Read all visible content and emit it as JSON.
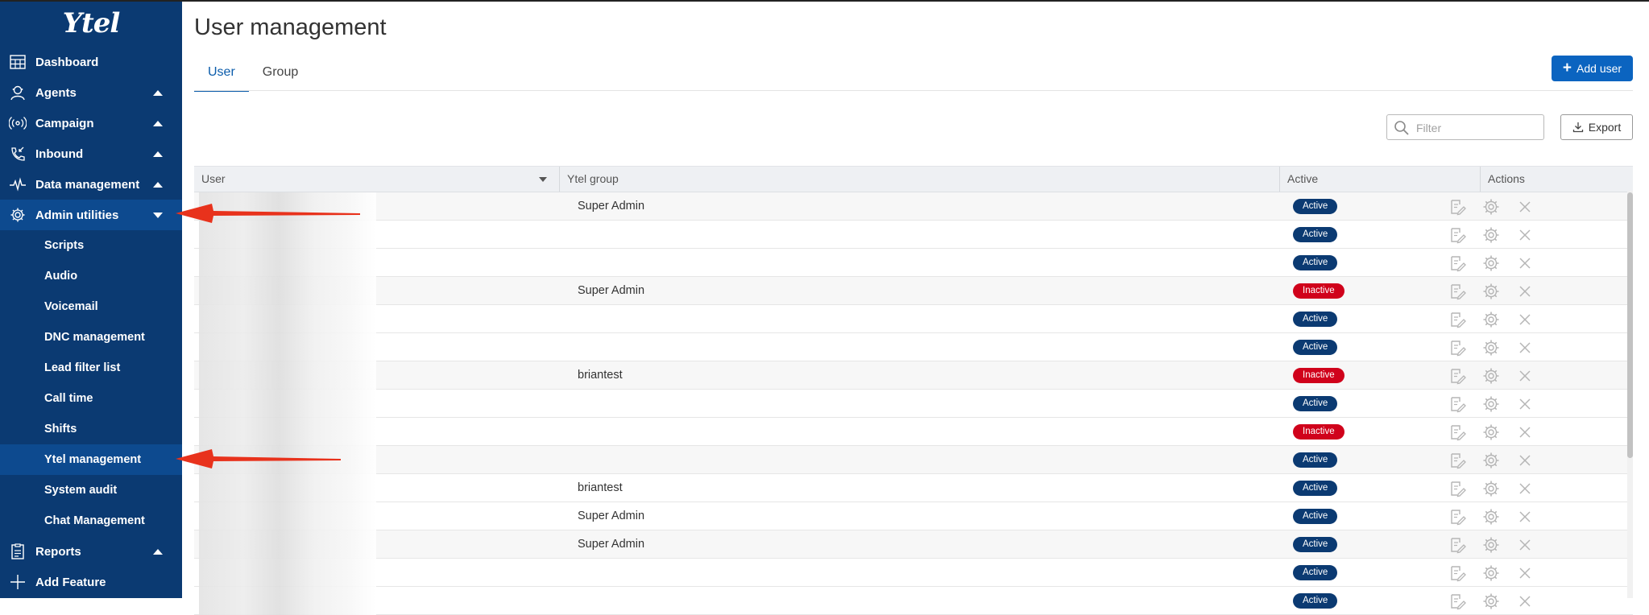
{
  "app": {
    "logo_text": "Ytel"
  },
  "sidebar": {
    "top_items": [
      {
        "label": "Dashboard",
        "icon": "dashboard-icon"
      },
      {
        "label": "Agents",
        "icon": "agent-icon",
        "caret": "up"
      },
      {
        "label": "Campaign",
        "icon": "broadcast-icon",
        "caret": "up"
      },
      {
        "label": "Inbound",
        "icon": "inbound-phone-icon",
        "caret": "up"
      },
      {
        "label": "Data management",
        "icon": "pulse-icon",
        "caret": "up"
      },
      {
        "label": "Admin utilities",
        "icon": "gear-icon",
        "caret": "down"
      }
    ],
    "sub_items": [
      "Scripts",
      "Audio",
      "Voicemail",
      "DNC management",
      "Lead filter list",
      "Call time",
      "Shifts",
      "Ytel management",
      "System audit",
      "Chat Management"
    ],
    "active_sub": "Ytel management",
    "bottom_items": [
      {
        "label": "Reports",
        "icon": "report-icon",
        "caret": "up"
      },
      {
        "label": "Add Feature",
        "icon": "plus-icon"
      }
    ]
  },
  "main": {
    "title": "User management",
    "tabs": [
      {
        "label": "User",
        "active": true
      },
      {
        "label": "Group",
        "active": false
      }
    ],
    "add_button": "Add user",
    "filter_placeholder": "Filter",
    "export_button": "Export"
  },
  "table": {
    "columns": [
      "User",
      "Ytel group",
      "Active",
      "Actions"
    ],
    "rows": [
      {
        "group": "Super Admin",
        "status": "Active"
      },
      {
        "group": "",
        "status": "Active"
      },
      {
        "group": "",
        "status": "Active"
      },
      {
        "group": "Super Admin",
        "status": "Inactive"
      },
      {
        "group": "",
        "status": "Active"
      },
      {
        "group": "",
        "status": "Active"
      },
      {
        "group": "briantest",
        "status": "Inactive"
      },
      {
        "group": "",
        "status": "Active"
      },
      {
        "group": "",
        "status": "Inactive"
      },
      {
        "group": "",
        "status": "Active"
      },
      {
        "group": "briantest",
        "status": "Active"
      },
      {
        "group": "Super Admin",
        "status": "Active"
      },
      {
        "group": "Super Admin",
        "status": "Active"
      },
      {
        "group": "",
        "status": "Active"
      },
      {
        "group": "",
        "status": "Active"
      }
    ]
  },
  "colors": {
    "sidebar_bg": "#0b3a72",
    "sidebar_active": "#0d4a8f",
    "primary": "#0b64c0",
    "badge_active": "#0b3a72",
    "badge_inactive": "#d0021b",
    "annotation_arrow": "#e8321c"
  }
}
